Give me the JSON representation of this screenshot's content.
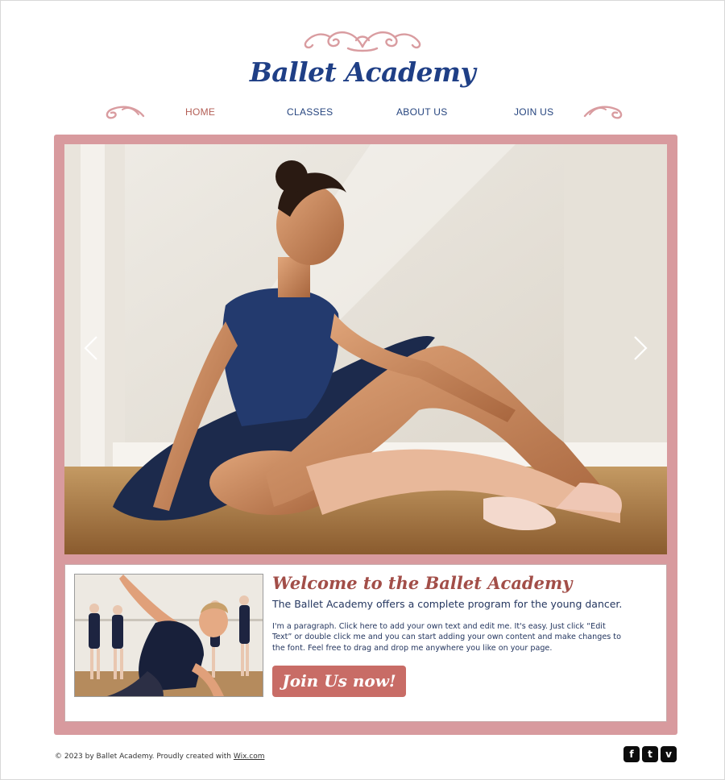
{
  "brand": {
    "name": "Ballet Academy",
    "colors": {
      "navy": "#1f3f86",
      "rose": "#d89a9e",
      "accent": "#b35e55",
      "button": "#c86c66"
    }
  },
  "nav": {
    "items": [
      {
        "label": "HOME",
        "active": true
      },
      {
        "label": "CLASSES",
        "active": false
      },
      {
        "label": "ABOUT US",
        "active": false
      },
      {
        "label": "JOIN US",
        "active": false
      }
    ]
  },
  "hero": {
    "prev_icon": "chevron-left-icon",
    "next_icon": "chevron-right-icon"
  },
  "welcome": {
    "title": "Welcome to the Ballet Academy",
    "subtitle": "The Ballet Academy offers a complete program for the young dancer.",
    "paragraph": "I'm a paragraph. Click here to add your own text and edit me. It's easy. Just click “Edit Text” or double click me and you can start adding your own content and make changes to the font. Feel free to drag and drop me anywhere you like on your page.",
    "button_label": "Join Us now!"
  },
  "footer": {
    "copyright_prefix": "© 2023 by Ballet Academy. Proudly created with ",
    "link_label": "Wix.com",
    "social": [
      {
        "name": "facebook-icon",
        "glyph": "f"
      },
      {
        "name": "twitter-icon",
        "glyph": "t"
      },
      {
        "name": "vimeo-icon",
        "glyph": "v"
      }
    ]
  }
}
